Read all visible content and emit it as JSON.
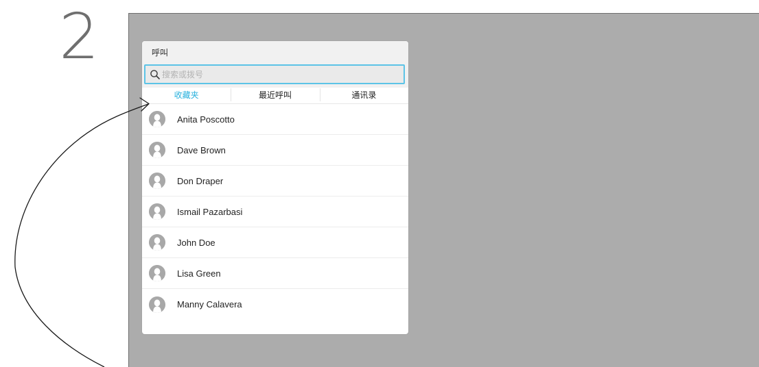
{
  "step": {
    "number": "2"
  },
  "colors": {
    "accent": "#28b1dd",
    "search_border": "#5bc3e6",
    "screen_background": "#acacac",
    "avatar": "#a8a8a8"
  },
  "dialog": {
    "title": "呼叫",
    "search": {
      "placeholder": "搜索或拨号",
      "value": "",
      "icon": "search-icon"
    },
    "tabs": [
      {
        "label": "收藏夹",
        "active": true
      },
      {
        "label": "最近呼叫",
        "active": false
      },
      {
        "label": "通讯录",
        "active": false
      }
    ],
    "contacts": [
      {
        "name": "Anita Poscotto",
        "icon": "avatar-icon"
      },
      {
        "name": "Dave Brown",
        "icon": "avatar-icon"
      },
      {
        "name": "Don Draper",
        "icon": "avatar-icon"
      },
      {
        "name": "Ismail Pazarbasi",
        "icon": "avatar-icon"
      },
      {
        "name": "John Doe",
        "icon": "avatar-icon"
      },
      {
        "name": "Lisa Green",
        "icon": "avatar-icon"
      },
      {
        "name": "Manny Calavera",
        "icon": "avatar-icon"
      }
    ]
  },
  "annotation": {
    "icon": "curved-arrow-icon",
    "points_to": "收藏夹"
  }
}
